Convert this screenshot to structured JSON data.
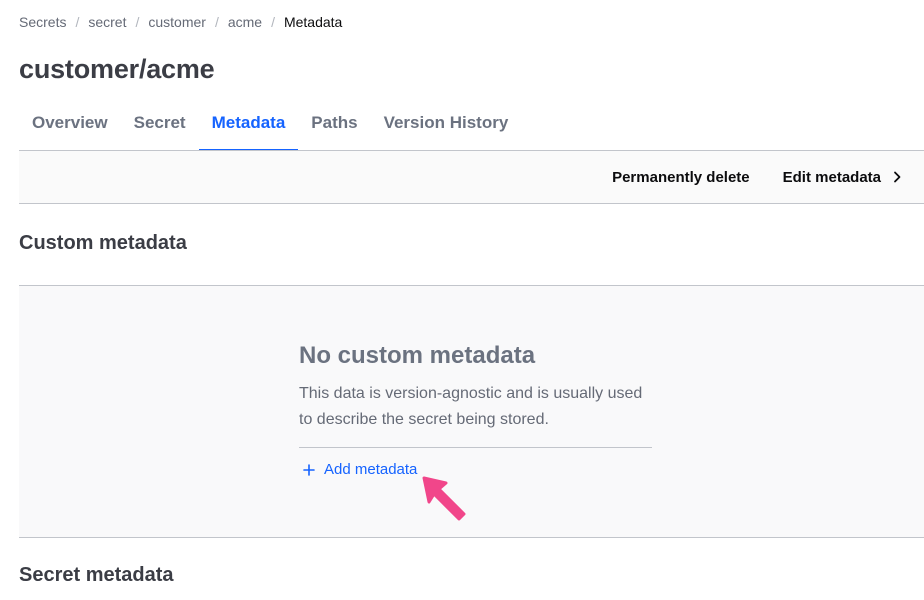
{
  "breadcrumb": [
    {
      "label": "Secrets"
    },
    {
      "label": "secret"
    },
    {
      "label": "customer"
    },
    {
      "label": "acme"
    },
    {
      "label": "Metadata",
      "current": true
    }
  ],
  "breadcrumb_separator": "/",
  "page": {
    "title": "customer/acme"
  },
  "tabs": [
    {
      "label": "Overview"
    },
    {
      "label": "Secret"
    },
    {
      "label": "Metadata",
      "active": true
    },
    {
      "label": "Paths"
    },
    {
      "label": "Version History"
    }
  ],
  "toolbar": {
    "delete_label": "Permanently delete",
    "edit_label": "Edit metadata",
    "edit_icon": "chevron-right-icon"
  },
  "sections": {
    "custom": {
      "title": "Custom metadata",
      "empty_state": {
        "title": "No custom metadata",
        "message": "This data is version-agnostic and is usually used to describe the secret being stored.",
        "action_label": "Add metadata",
        "action_icon": "plus-icon"
      }
    },
    "secret": {
      "title": "Secret metadata"
    }
  },
  "annotation": {
    "icon": "pointer-arrow-icon",
    "color": "#f1468a"
  },
  "colors": {
    "accent": "#1563ff",
    "border": "#c2c5cb",
    "panel_bg": "#f9f9fa"
  }
}
